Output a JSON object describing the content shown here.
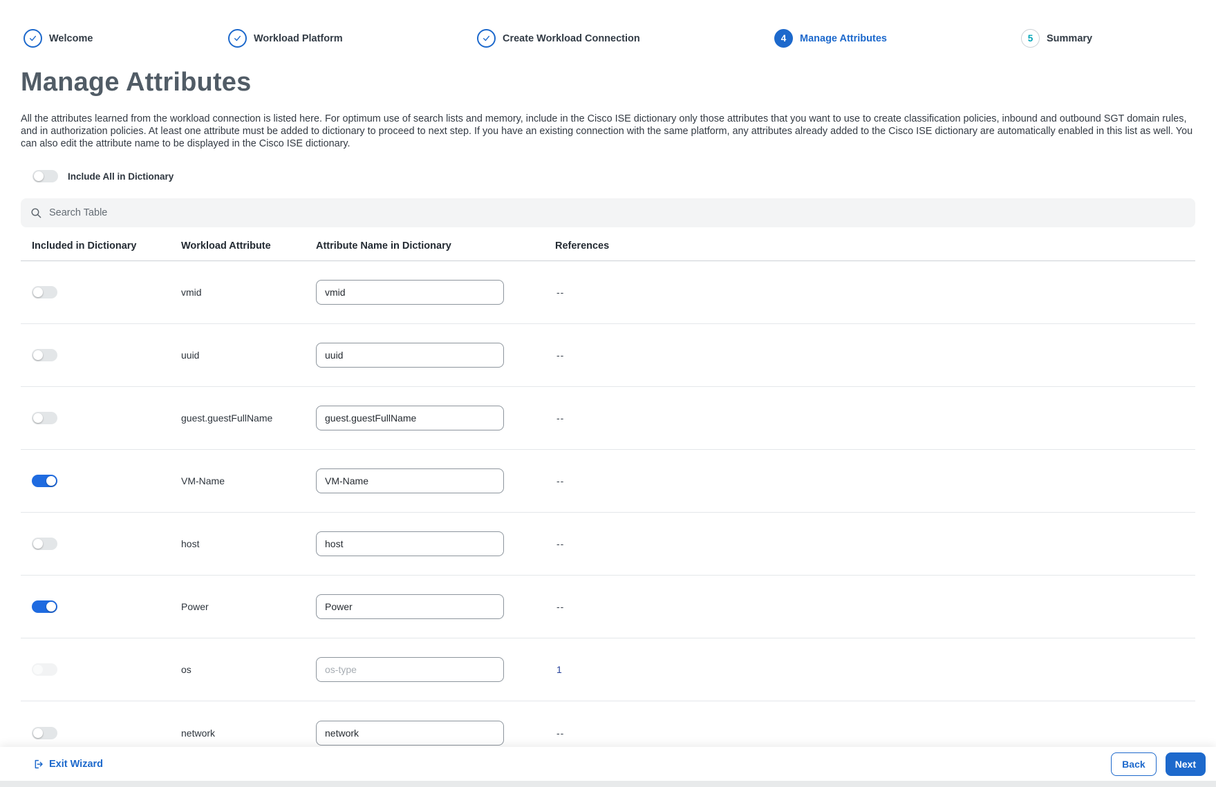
{
  "stepper": {
    "steps": [
      {
        "label": "Welcome",
        "state": "complete"
      },
      {
        "label": "Workload Platform",
        "state": "complete"
      },
      {
        "label": "Create Workload Connection",
        "state": "complete"
      },
      {
        "label": "Manage Attributes",
        "state": "current",
        "number": "4"
      },
      {
        "label": "Summary",
        "state": "upcoming",
        "number": "5"
      }
    ]
  },
  "page": {
    "title": "Manage Attributes",
    "description": "All the attributes learned from the workload connection is listed here. For optimum use of search lists and memory, include in the Cisco ISE dictionary only those attributes that you want to use to create classification policies, inbound and outbound SGT domain rules, and in authorization policies. At least one attribute must be added to dictionary to proceed to next step. If you have an existing connection with the same platform, any attributes already added to the Cisco ISE dictionary are automatically enabled in this list as well. You can also edit the attribute name to be displayed in the Cisco ISE dictionary."
  },
  "controls": {
    "include_all_label": "Include All in Dictionary",
    "include_all_on": false,
    "search_placeholder": "Search Table"
  },
  "table": {
    "columns": [
      "Included in Dictionary",
      "Workload Attribute",
      "Attribute Name in Dictionary",
      "References"
    ],
    "rows": [
      {
        "attribute": "vmid",
        "dictionary_name": "vmid",
        "placeholder": "",
        "references": "--",
        "included": false,
        "disabled": false,
        "reference_is_link": false
      },
      {
        "attribute": "uuid",
        "dictionary_name": "uuid",
        "placeholder": "",
        "references": "--",
        "included": false,
        "disabled": false,
        "reference_is_link": false
      },
      {
        "attribute": "guest.guestFullName",
        "dictionary_name": "guest.guestFullName",
        "placeholder": "",
        "references": "--",
        "included": false,
        "disabled": false,
        "reference_is_link": false
      },
      {
        "attribute": "VM-Name",
        "dictionary_name": "VM-Name",
        "placeholder": "",
        "references": "--",
        "included": true,
        "disabled": false,
        "reference_is_link": false
      },
      {
        "attribute": "host",
        "dictionary_name": "host",
        "placeholder": "",
        "references": "--",
        "included": false,
        "disabled": false,
        "reference_is_link": false
      },
      {
        "attribute": "Power",
        "dictionary_name": "Power",
        "placeholder": "",
        "references": "--",
        "included": true,
        "disabled": false,
        "reference_is_link": false
      },
      {
        "attribute": "os",
        "dictionary_name": "",
        "placeholder": "os-type",
        "references": "1",
        "included": false,
        "disabled": true,
        "reference_is_link": true
      },
      {
        "attribute": "network",
        "dictionary_name": "network",
        "placeholder": "",
        "references": "--",
        "included": false,
        "disabled": false,
        "reference_is_link": false
      }
    ]
  },
  "footer": {
    "exit_label": "Exit Wizard",
    "back_label": "Back",
    "next_label": "Next"
  },
  "colors": {
    "accent": "#1d69cc",
    "toggle_on": "#1f6be0",
    "step_upcoming_number": "#00a5b8",
    "reference_link": "#24409a"
  }
}
